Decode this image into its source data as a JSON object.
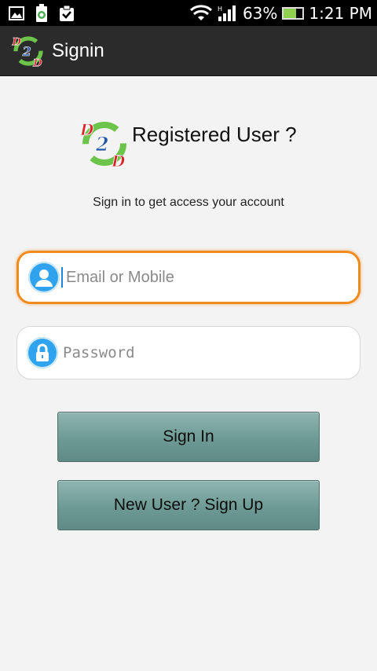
{
  "status_bar": {
    "battery_percent": "63%",
    "battery_level": 0.63,
    "time": "1:21 PM",
    "icons": [
      "gallery-icon",
      "battery-saver-icon",
      "clipboard-check-icon",
      "wifi-icon",
      "signal-icon",
      "battery-icon"
    ]
  },
  "action_bar": {
    "title": "Signin",
    "logo_letters": [
      "D",
      "2",
      "D"
    ]
  },
  "header": {
    "title": "Registered User ?",
    "logo_letters": [
      "D",
      "2",
      "D"
    ]
  },
  "subtitle": "Sign in to get access your account",
  "form": {
    "email": {
      "placeholder": "Email or Mobile",
      "value": ""
    },
    "password": {
      "placeholder": "Password",
      "value": ""
    }
  },
  "buttons": {
    "sign_in": "Sign In",
    "sign_up": "New User ? Sign Up"
  },
  "colors": {
    "focus_border": "#f08b1f",
    "icon_circle": "#2fa3ee",
    "button": "#7aa39e",
    "action_bar": "#2b2b2b"
  }
}
